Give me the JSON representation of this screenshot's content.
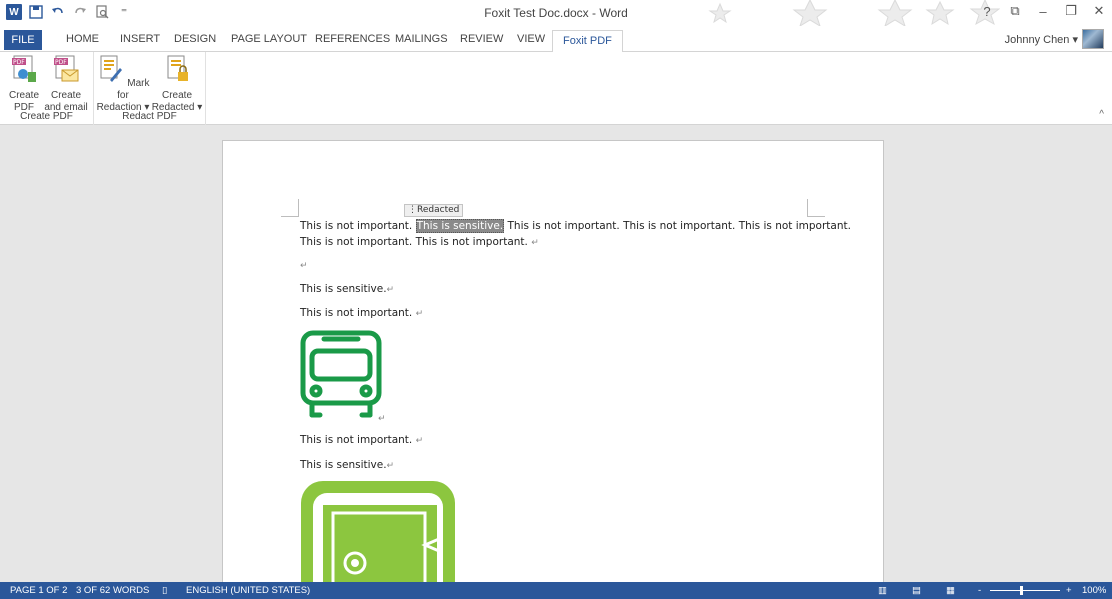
{
  "window": {
    "title": "Foxit Test Doc.docx - Word"
  },
  "qat": {
    "save": "save-icon",
    "undo": "undo-icon",
    "redo": "redo-icon",
    "preview": "print-preview-icon"
  },
  "tabs": [
    "FILE",
    "HOME",
    "INSERT",
    "DESIGN",
    "PAGE LAYOUT",
    "REFERENCES",
    "MAILINGS",
    "REVIEW",
    "VIEW",
    "Foxit PDF"
  ],
  "user": {
    "name": "Johnny Chen"
  },
  "ribbon": {
    "groups": [
      {
        "label": "Create PDF",
        "buttons": [
          {
            "line1": "Create",
            "line2": "PDF"
          },
          {
            "line1": "Create",
            "line2": "and email"
          }
        ]
      },
      {
        "label": "Redact PDF",
        "buttons": [
          {
            "line1": "Mark for",
            "line2": "Redaction ▾"
          },
          {
            "line1": "Create",
            "line2": "Redacted ▾"
          }
        ]
      }
    ],
    "collapse": "^"
  },
  "document": {
    "redact_tag": "⋮Redacted",
    "p1_before": "This is not important. ",
    "p1_highlight": "This is sensitive.",
    "p1_after": " This is not important. This is not important. This is not important.",
    "p1_line2": "This is not important. This is not important. ",
    "p3": "This is sensitive.",
    "p4": "This is not important. ",
    "p5": "This is not important. ",
    "p6": "This is sensitive.",
    "para_mark": "↵",
    "accent_green": "#1a9a48",
    "accent_lime": "#8cc63f"
  },
  "status": {
    "page": "PAGE 1 OF 2",
    "words": "3 OF 62 WORDS",
    "language": "ENGLISH (UNITED STATES)",
    "zoom": "100%",
    "zoom_minus": "-",
    "zoom_plus": "+"
  }
}
